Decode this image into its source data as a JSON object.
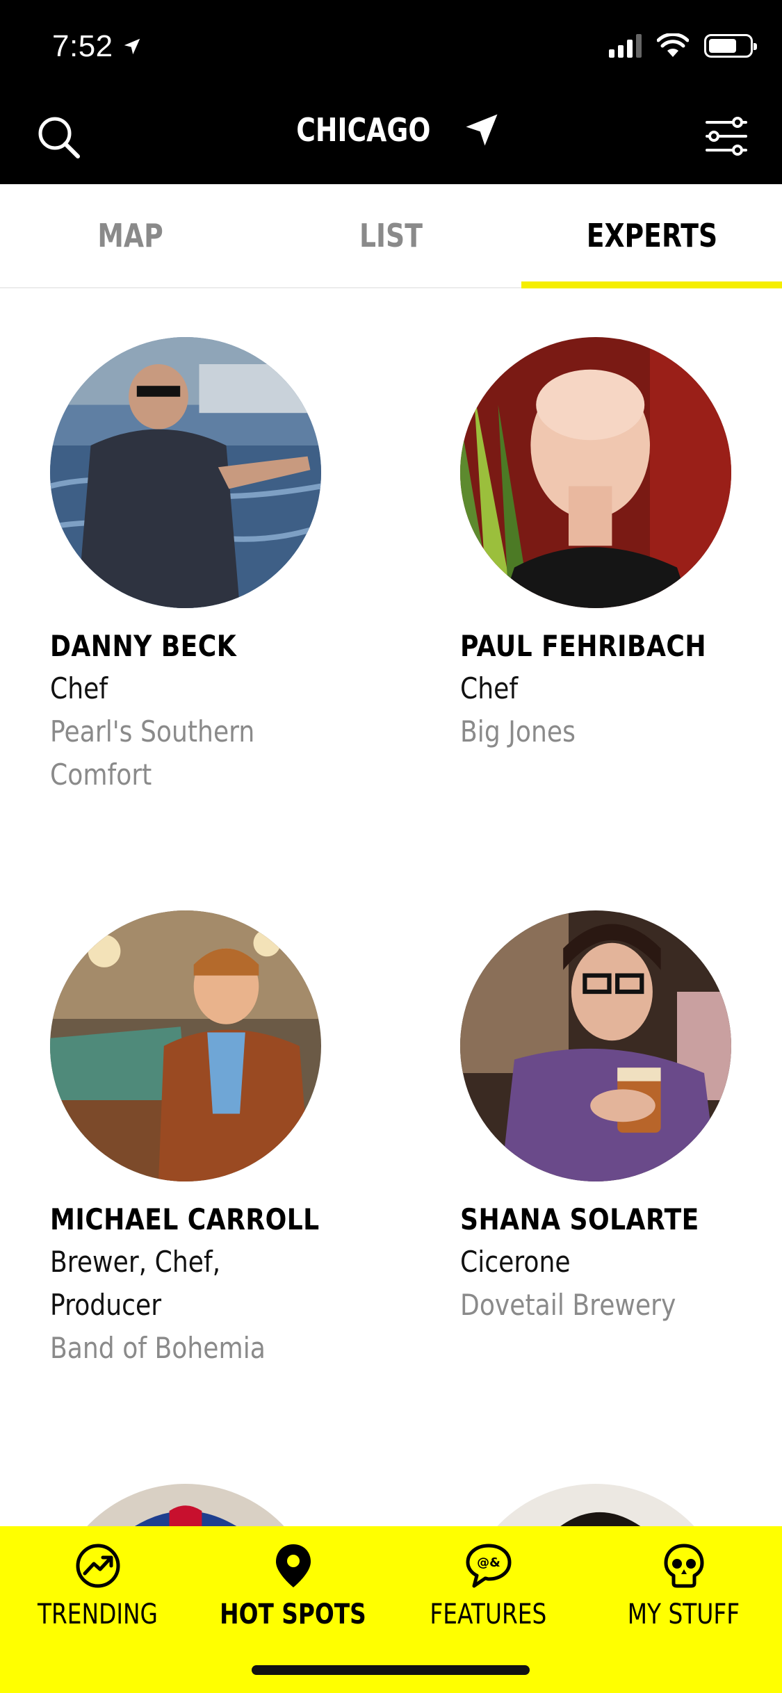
{
  "status_bar": {
    "time": "7:52"
  },
  "header": {
    "city": "CHICAGO",
    "search_icon": "search-icon",
    "location_icon": "navigation-arrow-icon",
    "filter_icon": "sliders-menu-icon"
  },
  "tabs": [
    {
      "label": "MAP",
      "active": false
    },
    {
      "label": "LIST",
      "active": false
    },
    {
      "label": "EXPERTS",
      "active": true
    }
  ],
  "experts": [
    {
      "name": "DANNY  BECK",
      "role": "Chef",
      "venue": "Pearl's Southern Comfort"
    },
    {
      "name": "PAUL FEHRIBACH",
      "role": "Chef",
      "venue": "Big Jones"
    },
    {
      "name": "MICHAEL CARROLL",
      "role": "Brewer, Chef, Producer",
      "venue": "Band of Bohemia"
    },
    {
      "name": "SHANA SOLARTE",
      "role": "Cicerone",
      "venue": "Dovetail Brewery"
    }
  ],
  "bottom_nav": [
    {
      "label": "TRENDING",
      "icon": "trending-up-icon",
      "active": false
    },
    {
      "label": "HOT SPOTS",
      "icon": "map-pin-icon",
      "active": true
    },
    {
      "label": "FEATURES",
      "icon": "chat-bubble-icon",
      "active": false
    },
    {
      "label": "MY STUFF",
      "icon": "skull-icon",
      "active": false
    }
  ],
  "colors": {
    "accent": "#ffff00",
    "header_bg": "#000000",
    "tab_underline": "#f5ee00",
    "muted_text": "#8a8a8a"
  }
}
